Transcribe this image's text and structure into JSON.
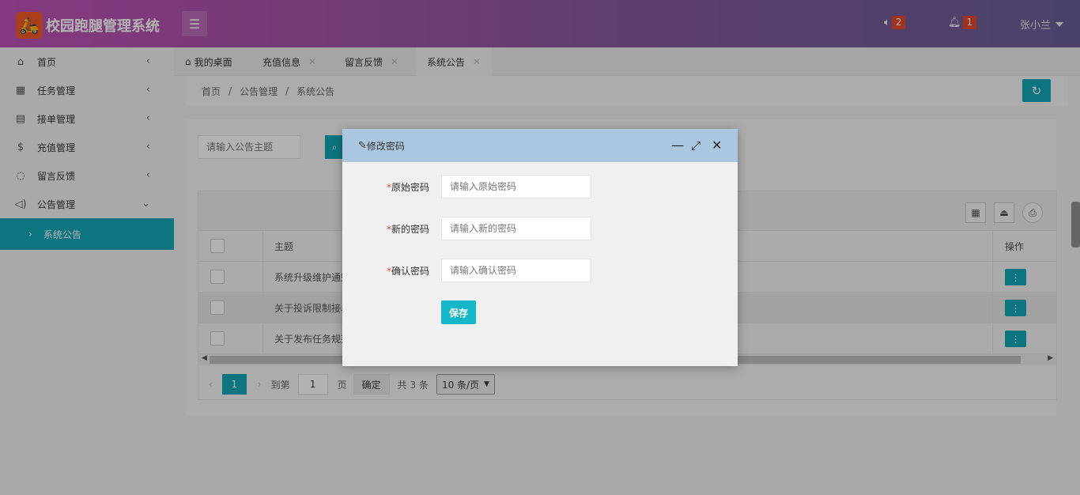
{
  "header": {
    "logo_text": "校园跑腿管理系统",
    "announce_count": "2",
    "notify_count": "1",
    "user_name": "张小兰"
  },
  "sidebar": {
    "items": [
      {
        "label": "首页"
      },
      {
        "label": "任务管理"
      },
      {
        "label": "接单管理"
      },
      {
        "label": "充值管理"
      },
      {
        "label": "留言反馈"
      },
      {
        "label": "公告管理"
      }
    ],
    "active_sub": "系统公告"
  },
  "tabs": [
    {
      "label": "我的桌面"
    },
    {
      "label": "充值信息"
    },
    {
      "label": "留言反馈"
    },
    {
      "label": "系统公告"
    }
  ],
  "breadcrumb": {
    "home": "首页",
    "section": "公告管理",
    "page": "系统公告",
    "sep": "/"
  },
  "search": {
    "placeholder": "请输入公告主题"
  },
  "table": {
    "column_title": "主题",
    "column_action": "操作",
    "rows": [
      {
        "title": "系统升级维护通知"
      },
      {
        "title": "关于投诉限制接单"
      },
      {
        "title": "关于发布任务规范"
      }
    ]
  },
  "pager": {
    "current": "1",
    "goto_label": "到第",
    "goto_value": "1",
    "page_unit": "页",
    "confirm": "确定",
    "total": "共 3 条",
    "page_size": "10 条/页"
  },
  "modal": {
    "title": "修改密码",
    "fields": [
      {
        "label": "原始密码",
        "placeholder": "请输入原始密码"
      },
      {
        "label": "新的密码",
        "placeholder": "请输入新的密码"
      },
      {
        "label": "确认密码",
        "placeholder": "请输入确认密码"
      }
    ],
    "required_mark": "*",
    "save": "保存"
  },
  "colors": {
    "accent": "#13a8b6",
    "badge": "#e5492b",
    "modal_header": "#abc7e0"
  }
}
